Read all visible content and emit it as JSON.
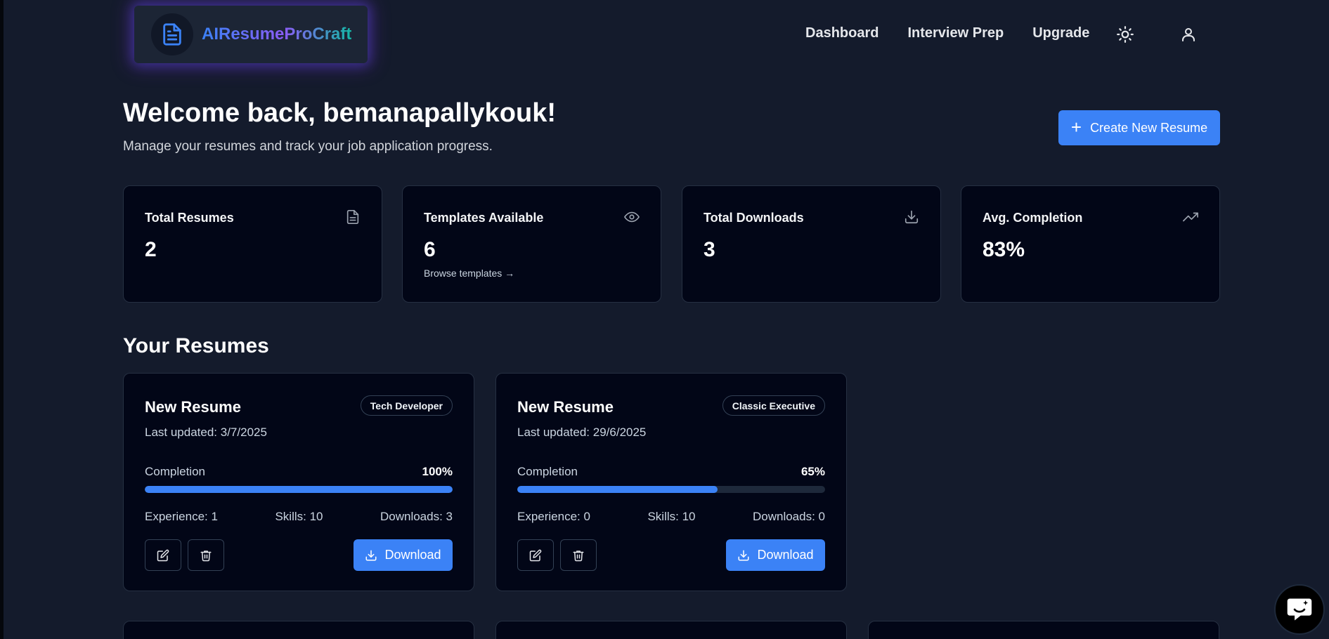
{
  "header": {
    "logo_text": "AIResumeProCraft",
    "nav": [
      {
        "label": "Dashboard"
      },
      {
        "label": "Interview Prep"
      },
      {
        "label": "Upgrade"
      }
    ]
  },
  "welcome": {
    "title": "Welcome back, bemanapallykouk!",
    "subtitle": "Manage your resumes and track your job application progress.",
    "create_button": "Create New Resume"
  },
  "stats": [
    {
      "label": "Total Resumes",
      "value": "2",
      "icon": "file-text-icon"
    },
    {
      "label": "Templates Available",
      "value": "6",
      "link": "Browse templates →",
      "icon": "eye-icon"
    },
    {
      "label": "Total Downloads",
      "value": "3",
      "icon": "download-icon"
    },
    {
      "label": "Avg. Completion",
      "value": "83%",
      "icon": "trending-up-icon"
    }
  ],
  "resumes_section": {
    "title": "Your Resumes",
    "items": [
      {
        "title": "New Resume",
        "template": "Tech Developer",
        "updated": "Last updated: 3/7/2025",
        "completion_label": "Completion",
        "completion_text": "100%",
        "completion": 100,
        "experience": "Experience: 1",
        "skills": "Skills: 10",
        "downloads": "Downloads: 3",
        "download_label": "Download"
      },
      {
        "title": "New Resume",
        "template": "Classic Executive",
        "updated": "Last updated: 29/6/2025",
        "completion_label": "Completion",
        "completion_text": "65%",
        "completion": 65,
        "experience": "Experience: 0",
        "skills": "Skills: 10",
        "downloads": "Downloads: 0",
        "download_label": "Download"
      }
    ]
  },
  "colors": {
    "accent": "#3b82f6",
    "background": "#141b2c",
    "card": "#020617"
  }
}
